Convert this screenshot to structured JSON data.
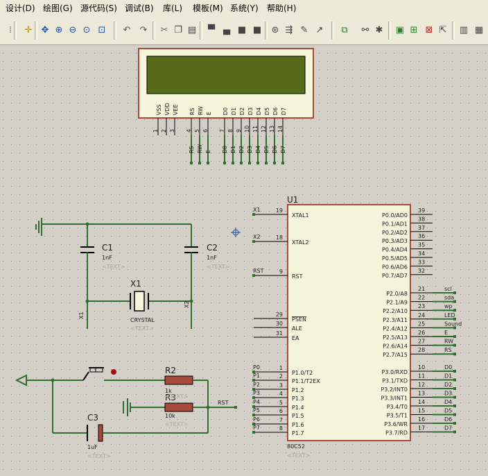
{
  "menu": [
    "设计(D)",
    "绘图(G)",
    "源代码(S)",
    "调试(B)",
    "库(L)",
    "模板(M)",
    "系统(Y)",
    "帮助(H)"
  ],
  "colors": {
    "wire": "#2e6e2e",
    "body": "#a84a3a",
    "fill": "#f5f5dc",
    "lcd": "#556b1a",
    "pin": "#000000",
    "text": "#1a1a1a",
    "ref": "#a8a89a",
    "canvas": "#d4d0c8"
  },
  "lcd": {
    "pins": [
      "VSS",
      "VDD",
      "VEE",
      "RS",
      "RW",
      "E",
      "D0",
      "D1",
      "D2",
      "D3",
      "D4",
      "D5",
      "D6",
      "D7"
    ],
    "nums": [
      "1",
      "2",
      "3",
      "4",
      "5",
      "6",
      "7",
      "8",
      "9",
      "10",
      "11",
      "12",
      "13",
      "14"
    ],
    "net_labels": [
      "RS",
      "RW",
      "E",
      "D0",
      "D1",
      "D2",
      "D3",
      "D4",
      "D5",
      "D6",
      "D7"
    ]
  },
  "u1": {
    "ref": "U1",
    "part": "80C52",
    "text": "<TEXT>",
    "left_pins": [
      {
        "num": "19",
        "name": "XTAL1",
        "net": "X1"
      },
      {
        "num": "18",
        "name": "XTAL2",
        "net": "X2"
      },
      {
        "num": "9",
        "name": "RST",
        "net": "RST"
      },
      {
        "num": "29",
        "name": "PSEN",
        "net": ""
      },
      {
        "num": "30",
        "name": "ALE",
        "net": ""
      },
      {
        "num": "31",
        "name": "EA",
        "net": ""
      },
      {
        "num": "1",
        "name": "P1.0/T2",
        "net": "P0"
      },
      {
        "num": "2",
        "name": "P1.1/T2EX",
        "net": "P1"
      },
      {
        "num": "3",
        "name": "P1.2",
        "net": "P2"
      },
      {
        "num": "4",
        "name": "P1.3",
        "net": "P3"
      },
      {
        "num": "5",
        "name": "P1.4",
        "net": "P4"
      },
      {
        "num": "6",
        "name": "P1.5",
        "net": "P5"
      },
      {
        "num": "7",
        "name": "P1.6",
        "net": "P6"
      },
      {
        "num": "8",
        "name": "P1.7",
        "net": "P7"
      }
    ],
    "port0": [
      {
        "num": "39",
        "name": "P0.0/AD0"
      },
      {
        "num": "38",
        "name": "P0.1/AD1"
      },
      {
        "num": "37",
        "name": "P0.2/AD2"
      },
      {
        "num": "36",
        "name": "P0.3/AD3"
      },
      {
        "num": "35",
        "name": "P0.4/AD4"
      },
      {
        "num": "34",
        "name": "P0.5/AD5"
      },
      {
        "num": "33",
        "name": "P0.6/AD6"
      },
      {
        "num": "32",
        "name": "P0.7/AD7"
      }
    ],
    "port2": [
      {
        "num": "21",
        "name": "P2.0/A8",
        "net": "scl"
      },
      {
        "num": "22",
        "name": "P2.1/A9",
        "net": "sda"
      },
      {
        "num": "23",
        "name": "P2.2/A10",
        "net": "wp"
      },
      {
        "num": "24",
        "name": "P2.3/A11",
        "net": "LED"
      },
      {
        "num": "25",
        "name": "P2.4/A12",
        "net": "Sound"
      },
      {
        "num": "26",
        "name": "P2.5/A13",
        "net": "E"
      },
      {
        "num": "27",
        "name": "P2.6/A14",
        "net": "RW"
      },
      {
        "num": "28",
        "name": "P2.7/A15",
        "net": "RS"
      }
    ],
    "port3": [
      {
        "num": "10",
        "name": "P3.0/RXD",
        "net": "D0"
      },
      {
        "num": "11",
        "name": "P3.1/TXD",
        "net": "D1"
      },
      {
        "num": "12",
        "name": "P3.2/INT0",
        "net": "D2"
      },
      {
        "num": "13",
        "name": "P3.3/INT1",
        "net": "D3"
      },
      {
        "num": "14",
        "name": "P3.4/T0",
        "net": "D4"
      },
      {
        "num": "15",
        "name": "P3.5/T1",
        "net": "D5"
      },
      {
        "num": "16",
        "name": "P3.6/WR",
        "net": "D6"
      },
      {
        "num": "17",
        "name": "P3.7/RD",
        "net": "D7"
      }
    ]
  },
  "parts": {
    "c1": {
      "ref": "C1",
      "val": "1nF",
      "text": "<TEXT>"
    },
    "c2": {
      "ref": "C2",
      "val": "1nF",
      "text": "<TEXT>"
    },
    "x1": {
      "ref": "X1",
      "val": "CRYSTAL",
      "text": "<TEXT>",
      "net_left": "X1",
      "net_right": "X2"
    },
    "r2": {
      "ref": "R2",
      "val": "1k",
      "text": "<TEXT>"
    },
    "r3": {
      "ref": "R3",
      "val": "10k",
      "text": "<TEXT>"
    },
    "c3": {
      "ref": "C3",
      "val": "1uF",
      "text": "<TEXT>"
    },
    "rst_label": "RST"
  }
}
